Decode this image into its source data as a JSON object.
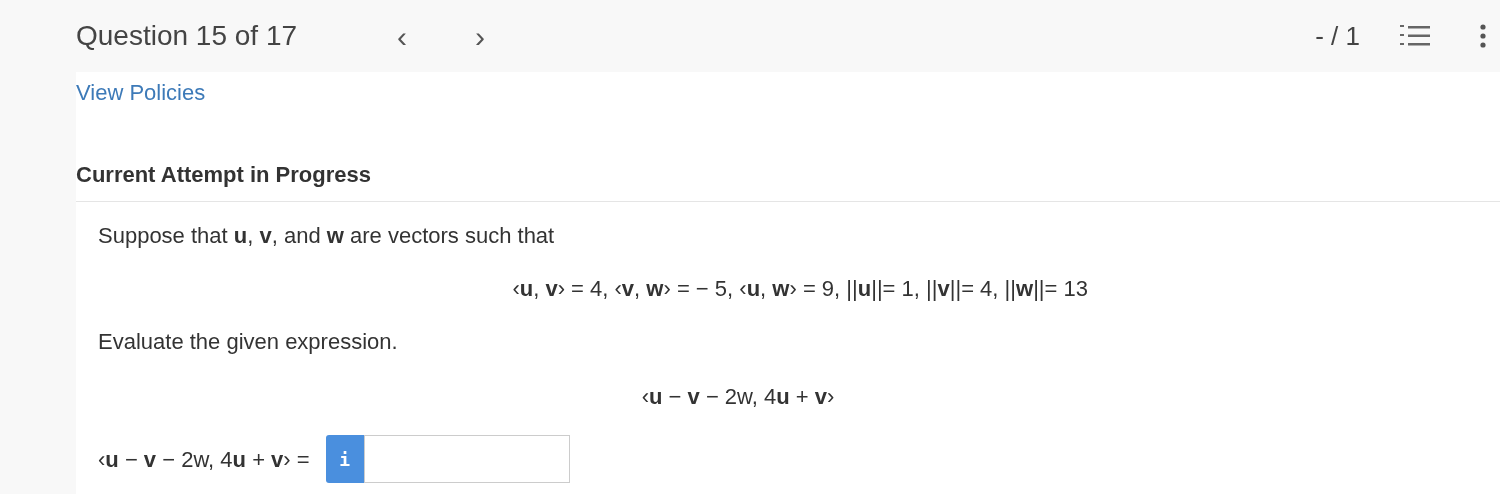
{
  "header": {
    "title": "Question 15 of 17",
    "prev": "‹",
    "next": "›",
    "score": "- / 1"
  },
  "policies_link": "View Policies",
  "attempt_heading": "Current Attempt in Progress",
  "question": {
    "intro": "Suppose that **u**, **v**, and **w** are vectors such that",
    "given": "‹**u**, **v**› = 4, ‹**v**, **w**› = − 5, ‹**u**, **w**› = 9, ||**u**||= 1, ||**v**||= 4, ||**w**||= 13",
    "instruction": "Evaluate the given expression.",
    "expression": "‹**u** − **v** − 2w, 4**u** + **v**›",
    "answer_label": "‹**u** − **v** − 2w, 4**u** + **v**› =",
    "info_button": "i"
  }
}
